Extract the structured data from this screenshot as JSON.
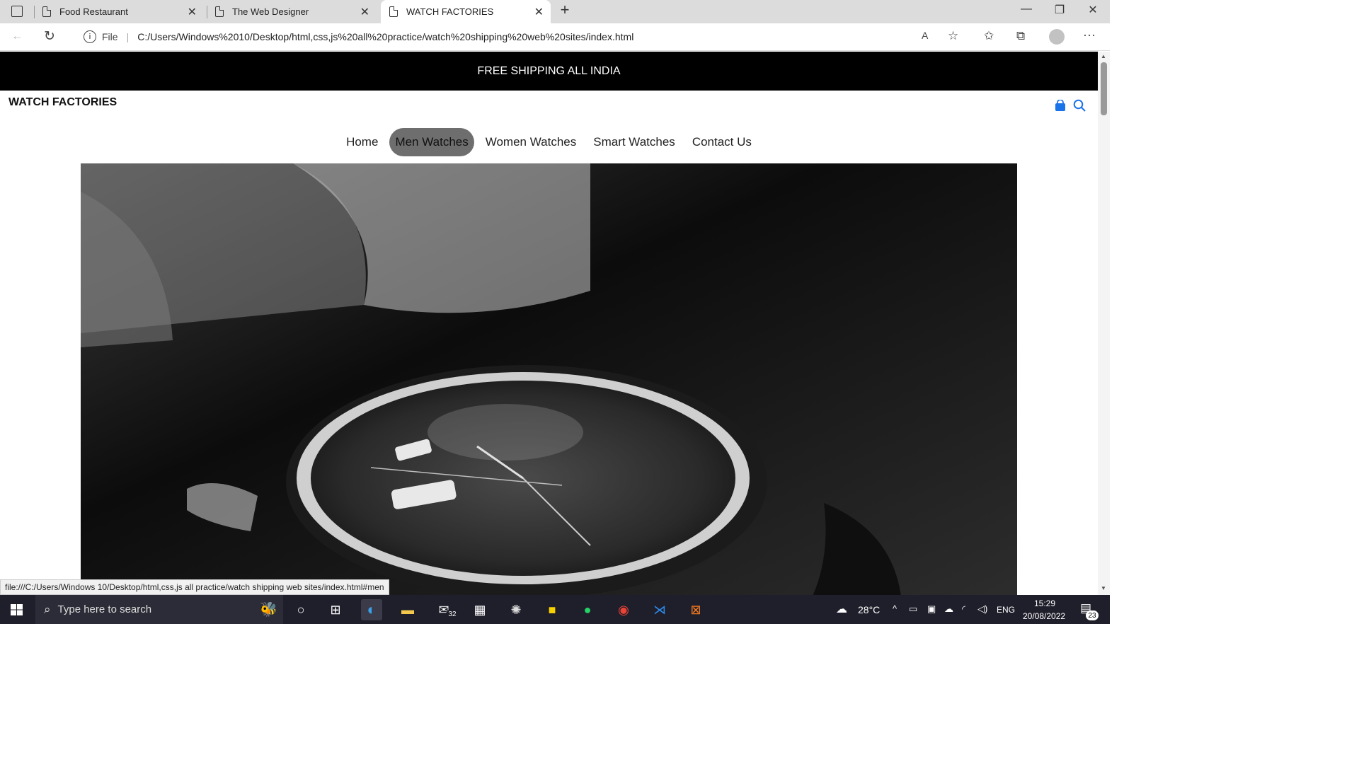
{
  "browser": {
    "tabs": [
      {
        "title": "Food Restaurant"
      },
      {
        "title": "The Web Designer"
      },
      {
        "title": "WATCH FACTORIES"
      }
    ],
    "address_prefix": "File",
    "url": "C:/Users/Windows%2010/Desktop/html,css,js%20all%20practice/watch%20shipping%20web%20sites/index.html",
    "status_link": "file:///C:/Users/Windows 10/Desktop/html,css,js all practice/watch shipping web sites/index.html#men"
  },
  "page": {
    "promo_text": "FREE SHIPPING ALL INDIA",
    "brand": "WATCH FACTORIES",
    "nav": [
      "Home",
      "Men Watches",
      "Women Watches",
      "Smart Watches",
      "Contact Us"
    ],
    "active_nav": "Men Watches",
    "accent_color": "#1a73e8"
  },
  "taskbar": {
    "search_placeholder": "Type here to search",
    "mail_badge": "32",
    "weather": "28°C",
    "language": "ENG",
    "time": "15:29",
    "date": "20/08/2022",
    "notifications": "23"
  }
}
